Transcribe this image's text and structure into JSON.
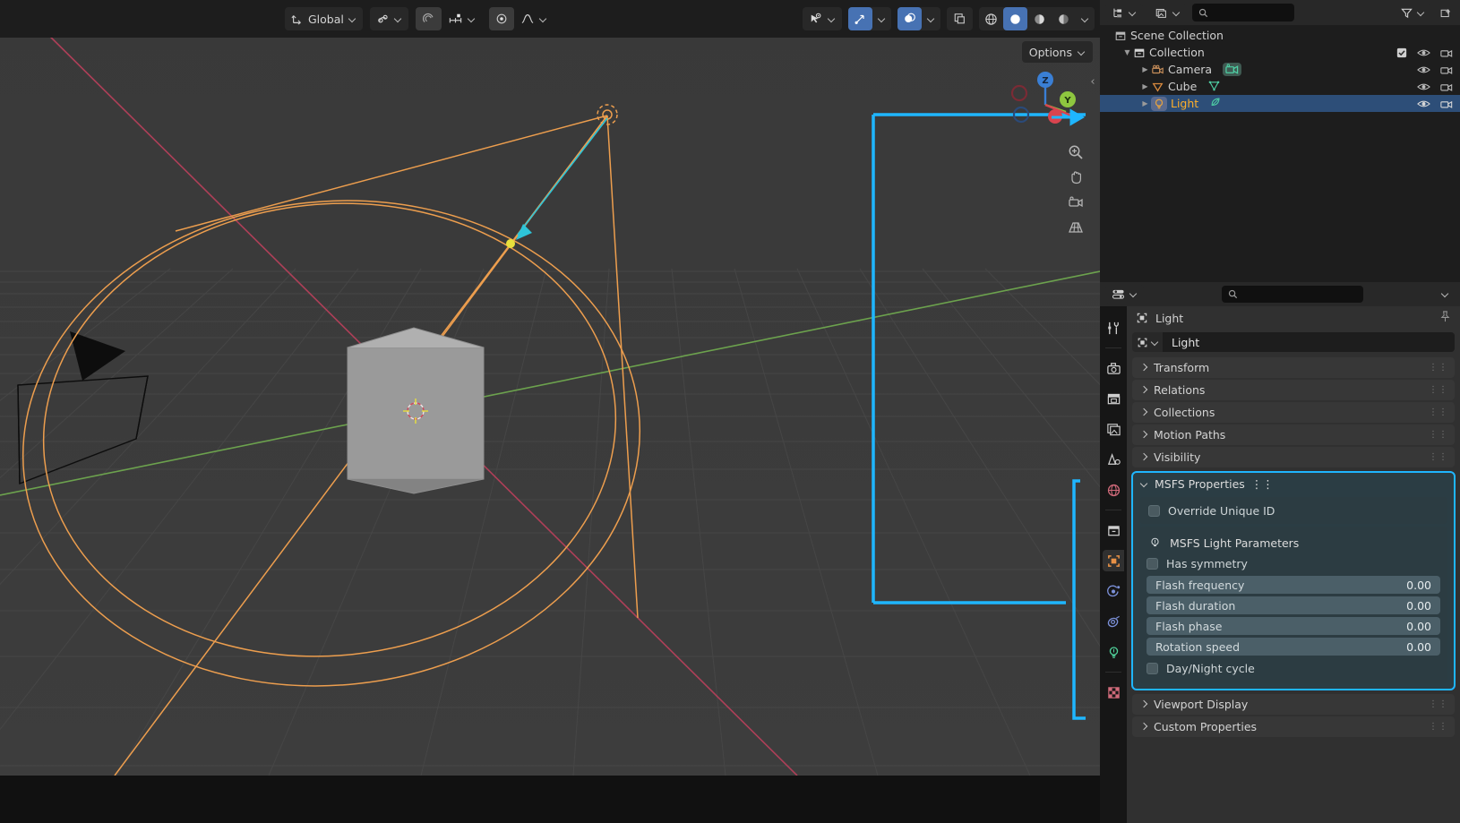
{
  "viewport": {
    "header": {
      "orientation_label": "Global",
      "snap_label": "",
      "proportional_label": "",
      "items": [
        {
          "name": "transform-orientation",
          "label": "Global"
        },
        {
          "name": "snap-magnet",
          "label": ""
        },
        {
          "name": "snap-target",
          "label": ""
        },
        {
          "name": "proportional-edit",
          "label": ""
        },
        {
          "name": "falloff",
          "label": ""
        }
      ],
      "right_items": [
        {
          "name": "visibility-selector",
          "label": ""
        },
        {
          "name": "gizmo-toggle",
          "label": ""
        },
        {
          "name": "overlays-toggle",
          "label": ""
        },
        {
          "name": "xray-toggle",
          "label": ""
        },
        {
          "name": "shading-wireframe",
          "label": ""
        },
        {
          "name": "shading-solid",
          "label": ""
        },
        {
          "name": "shading-material",
          "label": ""
        },
        {
          "name": "shading-rendered",
          "label": ""
        }
      ]
    },
    "options_label": "Options",
    "gizmo": {
      "axis_z": "Z",
      "axis_y": "Y",
      "axis_x": "X"
    },
    "tools": [
      {
        "name": "zoom-tool",
        "label": "zoom-icon"
      },
      {
        "name": "pan-tool",
        "label": "hand-icon"
      },
      {
        "name": "camera-view-tool",
        "label": "camera-icon"
      },
      {
        "name": "toggle-perspective-tool",
        "label": "grid-icon"
      }
    ]
  },
  "outliner": {
    "display_mode": "View Layer",
    "search_placeholder": "",
    "filter_label": "",
    "rows": [
      {
        "name": "scene-collection",
        "label": "Scene Collection",
        "indent": 0,
        "icon": "collection-icon",
        "selected": false,
        "has_tri": false
      },
      {
        "name": "collection",
        "label": "Collection",
        "indent": 1,
        "icon": "collection-icon",
        "selected": false,
        "has_tri": true
      },
      {
        "name": "camera",
        "label": "Camera",
        "indent": 2,
        "icon": "camera-data-icon",
        "selected": false,
        "has_tri": true
      },
      {
        "name": "cube",
        "label": "Cube",
        "indent": 2,
        "icon": "mesh-data-icon",
        "selected": false,
        "has_tri": true
      },
      {
        "name": "light",
        "label": "Light",
        "indent": 2,
        "icon": "light-data-icon",
        "selected": true,
        "has_tri": true
      }
    ]
  },
  "properties": {
    "search_placeholder": "",
    "breadcrumb": "Light",
    "id_name": "Light",
    "tabs": [
      {
        "name": "tool",
        "label": "tool-icon",
        "active": false
      },
      {
        "name": "render",
        "label": "render-camera-icon",
        "active": false
      },
      {
        "name": "output",
        "label": "output-printer-icon",
        "active": false
      },
      {
        "name": "view-layer",
        "label": "view-layer-images-icon",
        "active": false
      },
      {
        "name": "scene",
        "label": "scene-cone-icon",
        "active": false
      },
      {
        "name": "world",
        "label": "world-globe-icon",
        "active": false
      },
      {
        "name": "collection",
        "label": "collection-box-icon",
        "active": false
      },
      {
        "name": "object",
        "label": "object-square-icon",
        "active": true
      },
      {
        "name": "modifiers",
        "label": "physics-orbit-icon",
        "active": false
      },
      {
        "name": "constraints",
        "label": "constraints-icon",
        "active": false
      },
      {
        "name": "object-data",
        "label": "light-data-bulb-icon",
        "active": false
      },
      {
        "name": "texture",
        "label": "texture-checker-icon",
        "active": false
      }
    ],
    "panels_top": [
      {
        "name": "transform",
        "label": "Transform",
        "open": false
      },
      {
        "name": "relations",
        "label": "Relations",
        "open": false
      },
      {
        "name": "collections",
        "label": "Collections",
        "open": false
      },
      {
        "name": "motion-paths",
        "label": "Motion Paths",
        "open": false
      },
      {
        "name": "visibility",
        "label": "Visibility",
        "open": false
      }
    ],
    "msfs": {
      "title": "MSFS Properties",
      "override_unique_id": {
        "label": "Override Unique ID",
        "checked": false
      },
      "light_params_title": "MSFS Light Parameters",
      "has_symmetry": {
        "label": "Has symmetry",
        "checked": false
      },
      "sliders": [
        {
          "name": "flash-frequency",
          "label": "Flash frequency",
          "value": "0.00"
        },
        {
          "name": "flash-duration",
          "label": "Flash duration",
          "value": "0.00"
        },
        {
          "name": "flash-phase",
          "label": "Flash phase",
          "value": "0.00"
        },
        {
          "name": "rotation-speed",
          "label": "Rotation speed",
          "value": "0.00"
        }
      ],
      "day_night_cycle": {
        "label": "Day/Night cycle",
        "checked": false
      },
      "highlight_color": "#1fb6ff"
    },
    "panels_bottom": [
      {
        "name": "viewport-display",
        "label": "Viewport Display",
        "open": false
      },
      {
        "name": "custom-properties",
        "label": "Custom Properties",
        "open": false
      }
    ]
  },
  "colors": {
    "accent_cyan": "#1fb6ff",
    "selection_orange": "#ed9e4e",
    "outliner_selected": "#2d4e78",
    "axis_x_red": "#b5405a",
    "axis_y_green": "#6fa84f"
  }
}
